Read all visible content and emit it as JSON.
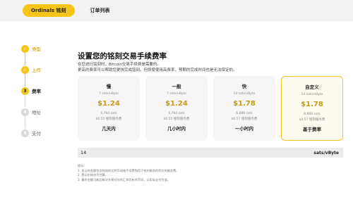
{
  "tabs": [
    {
      "label": "Ordinals 铭刻",
      "active": true
    },
    {
      "label": "订单列表",
      "active": false
    }
  ],
  "steps": [
    {
      "num": "✓",
      "label": "类型",
      "state": "done"
    },
    {
      "num": "✓",
      "label": "上传",
      "state": "done"
    },
    {
      "num": "3",
      "label": "费率",
      "state": "active"
    },
    {
      "num": "4",
      "label": "地址",
      "state": "todo"
    },
    {
      "num": "5",
      "label": "支付",
      "state": "todo"
    }
  ],
  "heading": "设置您的铭刻交易手续费率",
  "description": [
    "在您进行铭刻时，Bitcoin交易手续费是需要的。",
    "更高的费率可以帮助您更快完成铭刻。但即使使用高费率，预期的完成时间也是无法保证的。"
  ],
  "fee_cards": [
    {
      "name": "慢",
      "rate": "7 sats/vByte",
      "usd": "$1.24",
      "sats": "4,794 sats",
      "fee": "$0.55 铭刻服务费",
      "eta": "几天内",
      "selected": false
    },
    {
      "name": "一般",
      "rate": "7 sats/vByte",
      "usd": "$1.24",
      "sats": "4,794 sats",
      "fee": "$0.55 铭刻服务费",
      "eta": "几小时内",
      "selected": false
    },
    {
      "name": "快",
      "rate": "14 sats/vByte",
      "usd": "$1.78",
      "sats": "6,888 sats",
      "fee": "$0.57 铭刻服务费",
      "eta": "一小时内",
      "selected": false
    },
    {
      "name": "自定义",
      "rate": "14 sats/vByte",
      "usd": "$1.78",
      "sats": "6,888 sats",
      "fee": "$0.57 铭刻服务费",
      "eta": "基于费率",
      "selected": true
    }
  ],
  "custom_rate": {
    "value": "14",
    "unit": "sats/vByte"
  },
  "tips": {
    "title": "提示:",
    "items": [
      "1. 显示的金额包含铭刻的比特币网络手续费和用于铭刻服务的明文的服务费。",
      "2. 费示价格仅为估算。",
      "3. 最终金额可能因每次交易对应的汇率而有所不同，以实际支付为准。"
    ]
  },
  "colors": {
    "accent": "#f5c518",
    "price": "#c89a10"
  }
}
